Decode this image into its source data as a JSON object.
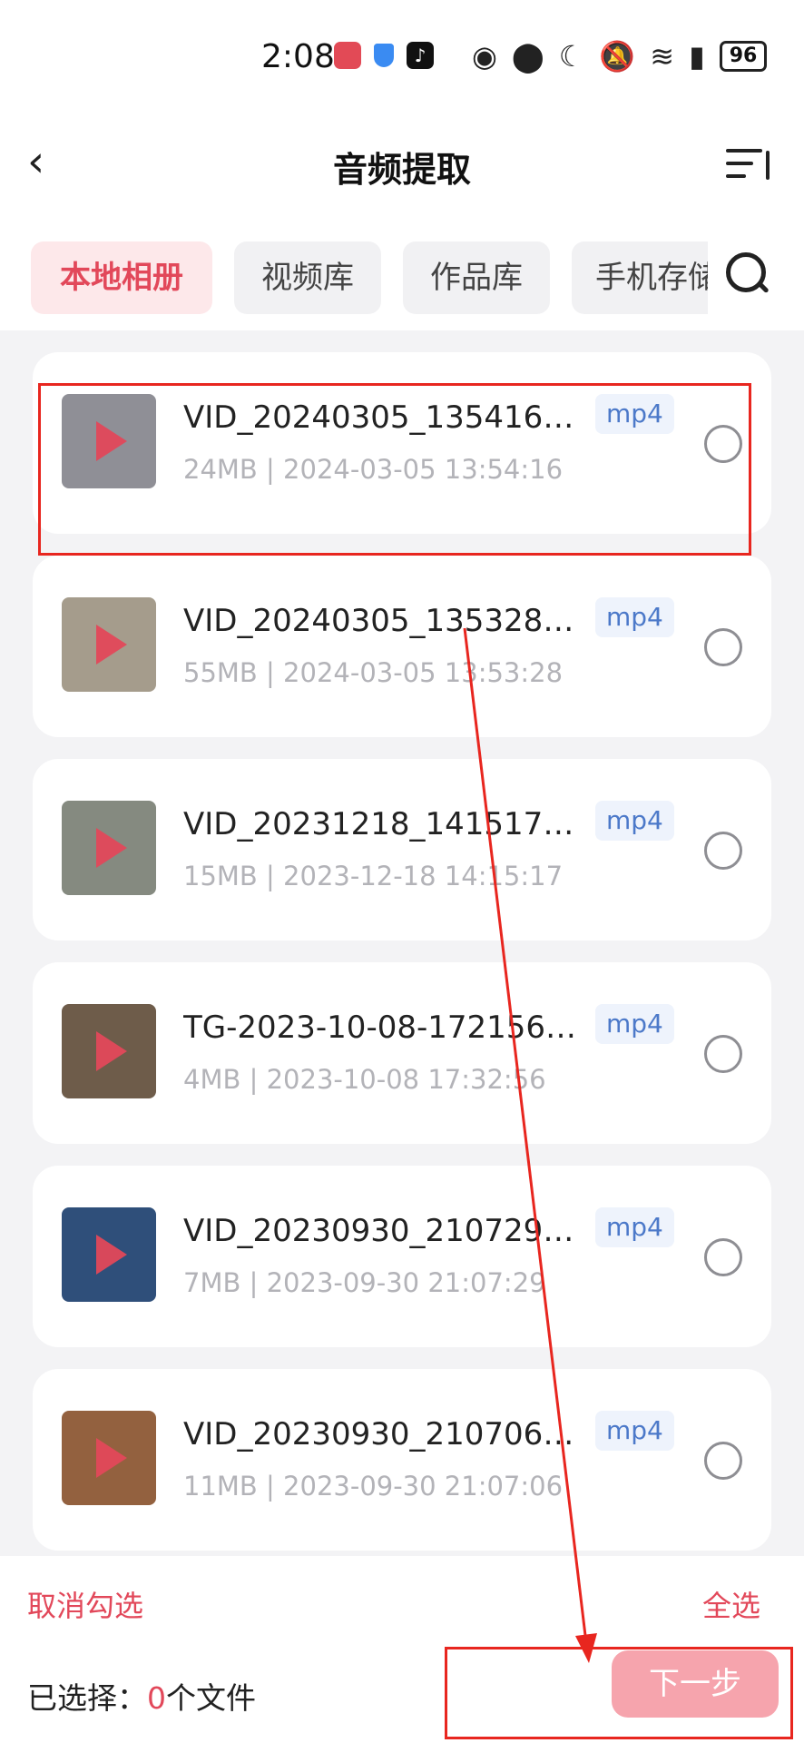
{
  "status_bar": {
    "time": "2:08",
    "battery": "96"
  },
  "header": {
    "title": "音频提取"
  },
  "tabs": [
    {
      "label": "本地相册",
      "active": true
    },
    {
      "label": "视频库",
      "active": false
    },
    {
      "label": "作品库",
      "active": false
    },
    {
      "label": "手机存储",
      "active": false
    }
  ],
  "files": [
    {
      "name": "VID_20240305_135416.mp4",
      "size": "24MB",
      "date": "2024-03-05 13:54:16",
      "format": "mp4",
      "thumb_color": "#8f8f96"
    },
    {
      "name": "VID_20240305_135328.mp4",
      "size": "55MB",
      "date": "2024-03-05 13:53:28",
      "format": "mp4",
      "thumb_color": "#a59c8c"
    },
    {
      "name": "VID_20231218_141517.mp4",
      "size": "15MB",
      "date": "2023-12-18 14:15:17",
      "format": "mp4",
      "thumb_color": "#858a80"
    },
    {
      "name": "TG-2023-10-08-172156.mp4",
      "size": "4MB",
      "date": "2023-10-08 17:32:56",
      "format": "mp4",
      "thumb_color": "#6e5c4a"
    },
    {
      "name": "VID_20230930_210729.mp4",
      "size": "7MB",
      "date": "2023-09-30 21:07:29",
      "format": "mp4",
      "thumb_color": "#2f4f7a"
    },
    {
      "name": "VID_20230930_210706.mp4",
      "size": "11MB",
      "date": "2023-09-30 21:07:06",
      "format": "mp4",
      "thumb_color": "#93613f"
    }
  ],
  "bottom": {
    "cancel_label": "取消勾选",
    "select_all_label": "全选",
    "selected_prefix": "已选择：",
    "selected_count": "0",
    "selected_suffix": "个文件",
    "next_label": "下一步"
  },
  "colors": {
    "accent": "#e2485a",
    "annotation": "#e8261f"
  }
}
